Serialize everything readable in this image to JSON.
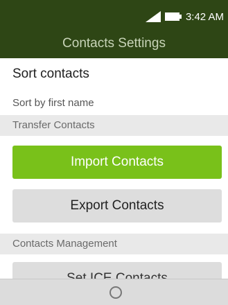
{
  "status": {
    "time": "3:42 AM"
  },
  "header": {
    "title": "Contacts Settings"
  },
  "sort": {
    "title": "Sort contacts",
    "value": "Sort by first name"
  },
  "sections": {
    "transfer": "Transfer Contacts",
    "management": "Contacts Management"
  },
  "buttons": {
    "import": "Import Contacts",
    "export": "Export Contacts",
    "ice": "Set ICE Contacts"
  },
  "colors": {
    "header": "#2e4615",
    "accent": "#79c11a"
  },
  "softkeys": {
    "center_icon": "circle-select-icon"
  }
}
